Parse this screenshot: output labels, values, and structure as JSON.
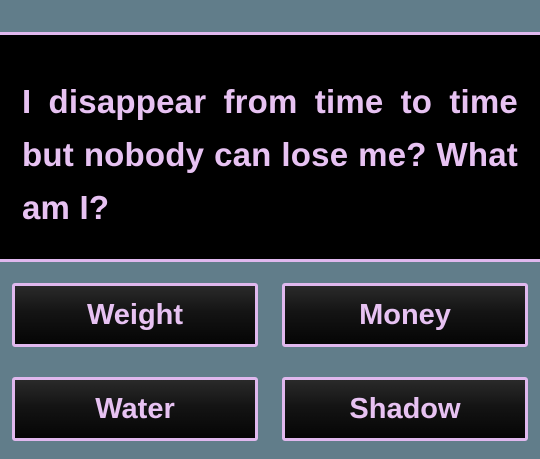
{
  "question": {
    "text": "I disappear from time to time but nobody can lose me? What am I?"
  },
  "answers": [
    {
      "label": "Weight"
    },
    {
      "label": "Money"
    },
    {
      "label": "Water"
    },
    {
      "label": "Shadow"
    }
  ],
  "colors": {
    "background": "#617d8a",
    "panel": "#000000",
    "accent": "#e0b8ee",
    "text": "#e7c2f2"
  }
}
